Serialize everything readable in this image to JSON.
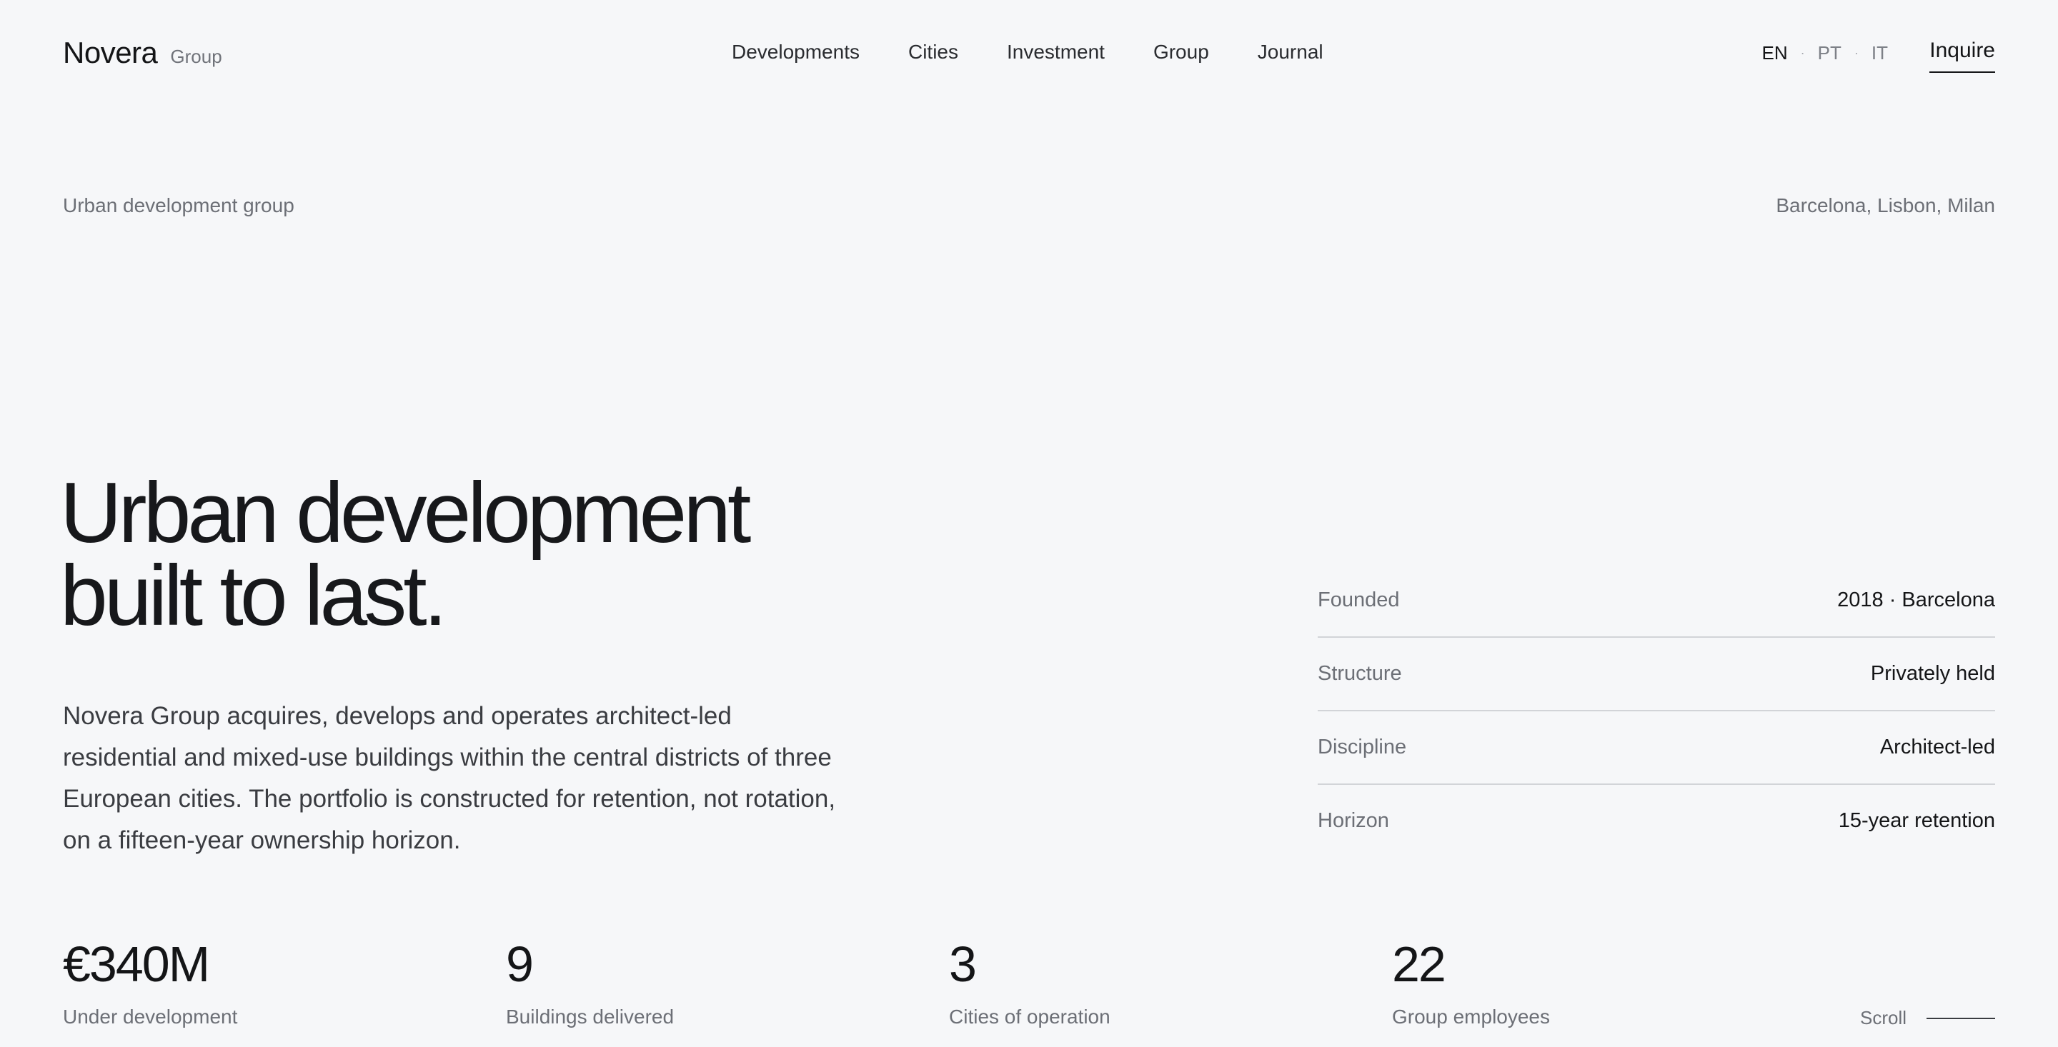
{
  "header": {
    "brand_name": "Novera",
    "brand_sub": "Group",
    "nav": [
      "Developments",
      "Cities",
      "Investment",
      "Group",
      "Journal"
    ],
    "languages": [
      "EN",
      "PT",
      "IT"
    ],
    "language_separator": "·",
    "active_language": "EN",
    "cta": "Inquire"
  },
  "eyebrow": {
    "left": "Urban development group",
    "right": "Barcelona, Lisbon, Milan"
  },
  "hero": {
    "title_line1": "Urban development",
    "title_line2": "built to last.",
    "body": "Novera Group acquires, develops and operates architect-led residential and mixed-use buildings within the central districts of three European cities. The portfolio is constructed for retention, not rotation, on a fifteen-year ownership horizon."
  },
  "facts": [
    {
      "label": "Founded",
      "value": "2018 · Barcelona"
    },
    {
      "label": "Structure",
      "value": "Privately held"
    },
    {
      "label": "Discipline",
      "value": "Architect-led"
    },
    {
      "label": "Horizon",
      "value": "15-year retention"
    }
  ],
  "stats": [
    {
      "value": "€340M",
      "label": "Under development"
    },
    {
      "value": "9",
      "label": "Buildings delivered"
    },
    {
      "value": "3",
      "label": "Cities of operation"
    },
    {
      "value": "22",
      "label": "Group employees"
    }
  ],
  "scroll_label": "Scroll",
  "colors": {
    "background": "#f6f7f9",
    "text": "#141517",
    "muted": "#6c6f76",
    "divider": "#d2d4d8"
  }
}
